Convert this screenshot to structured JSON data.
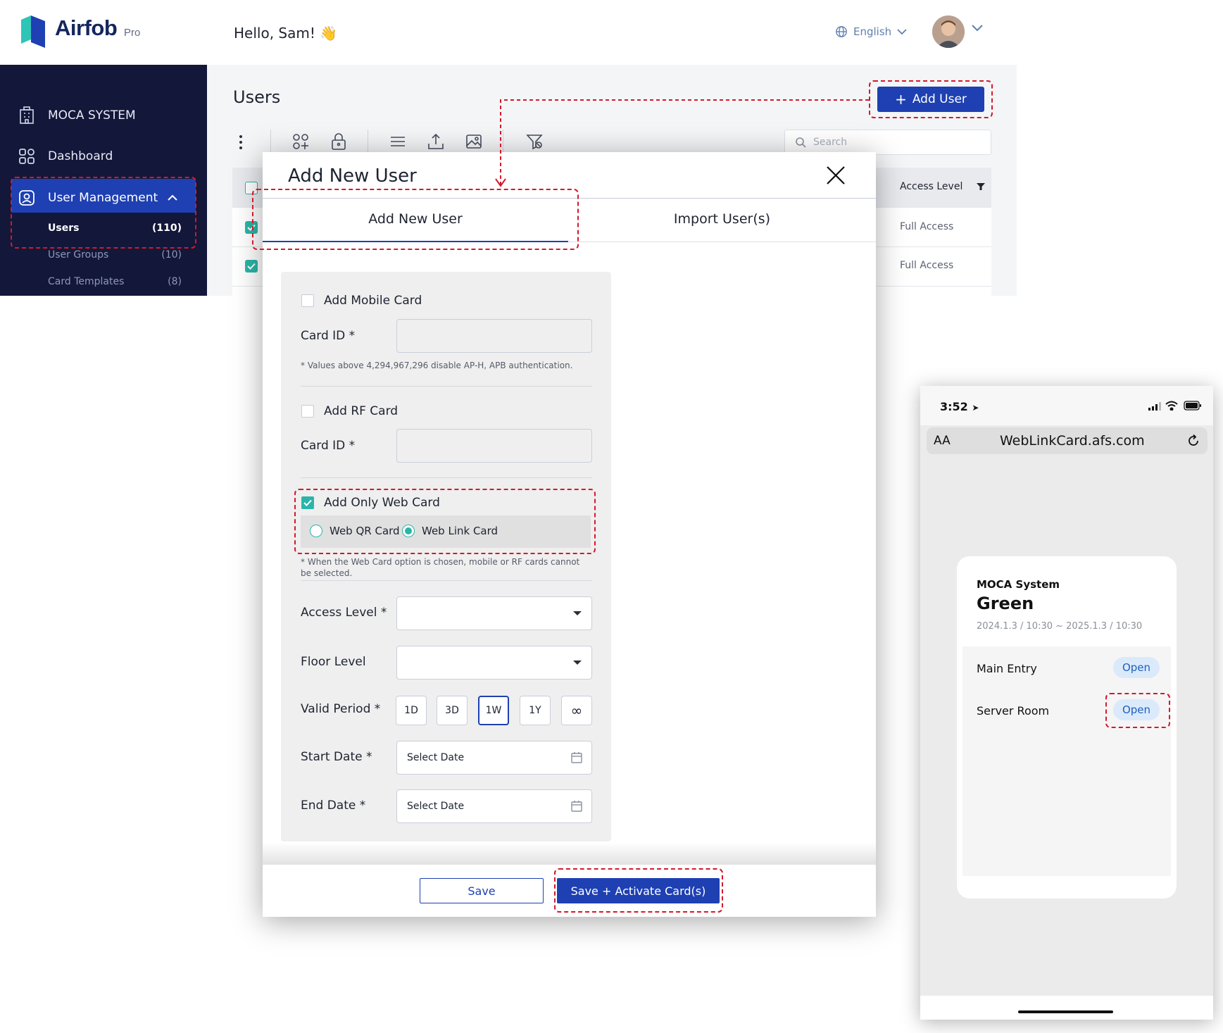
{
  "brand": {
    "name": "Airfob",
    "tier": "Pro"
  },
  "header": {
    "greeting": "Hello, Sam! 👋",
    "language": "English"
  },
  "sidebar": {
    "items": [
      {
        "label": "MOCA SYSTEM"
      },
      {
        "label": "Dashboard"
      },
      {
        "label": "User Management"
      }
    ],
    "sub_items": [
      {
        "label": "Users",
        "count": "(110)"
      },
      {
        "label": "User Groups",
        "count": "(10)"
      },
      {
        "label": "Card Templates",
        "count": "(8)"
      }
    ]
  },
  "users_page": {
    "title": "Users",
    "add_user_label": "Add User",
    "search_placeholder": "Search",
    "column_access_level": "Access Level",
    "rows": [
      {
        "access": "Full Access"
      },
      {
        "access": "Full Access"
      }
    ]
  },
  "modal": {
    "title": "Add New User",
    "tabs": [
      "Add New User",
      "Import User(s)"
    ],
    "mobile_card_label": "Add Mobile Card",
    "card_id_label": "Card ID *",
    "card_id_note": "* Values above 4,294,967,296 disable AP-H, APB authentication.",
    "rf_card_label": "Add RF Card",
    "web_card_label": "Add Only Web Card",
    "web_qr_label": "Web QR Card",
    "web_link_label": "Web Link Card",
    "web_card_note": "* When the Web Card option is chosen, mobile or RF cards cannot be selected.",
    "access_level_label": "Access Level *",
    "floor_level_label": "Floor Level",
    "valid_period_label": "Valid Period *",
    "periods": [
      "1D",
      "3D",
      "1W",
      "1Y",
      "∞"
    ],
    "selected_period": "1W",
    "start_date_label": "Start Date *",
    "end_date_label": "End Date *",
    "date_placeholder": "Select Date",
    "save_label": "Save",
    "save_activate_label": "Save + Activate Card(s)"
  },
  "phone": {
    "time": "3:52",
    "aa": "AA",
    "url": "WebLinkCard.afs.com",
    "system": "MOCA System",
    "user_name": "Green",
    "period": "2024.1.3 / 10:30 ~ 2025.1.3 / 10:30",
    "doors": [
      {
        "name": "Main Entry",
        "action": "Open"
      },
      {
        "name": "Server Room",
        "action": "Open"
      }
    ]
  },
  "colors": {
    "primary": "#1e40b2",
    "sidebar": "#13173a",
    "teal": "#2bb5a8",
    "annotation": "#d3192c"
  }
}
